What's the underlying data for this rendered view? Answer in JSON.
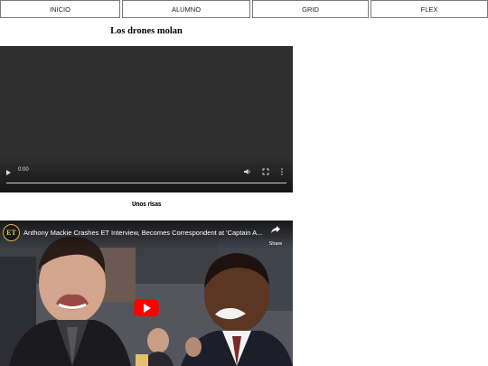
{
  "nav": {
    "items": [
      "INICIO",
      "ALUMNO",
      "GRID",
      "FLEX"
    ]
  },
  "main": {
    "title": "Los drones molan",
    "video": {
      "time": "0:00"
    },
    "subtitle": "Unos risas",
    "youtube": {
      "channel_logo": "ET",
      "title": "Anthony Mackie Crashes ET Interview, Becomes Correspondent at 'Captain A...",
      "share_label": "Share"
    }
  },
  "colors": {
    "youtube_red": "#ff0000",
    "video_bg": "#2f2f2f"
  }
}
